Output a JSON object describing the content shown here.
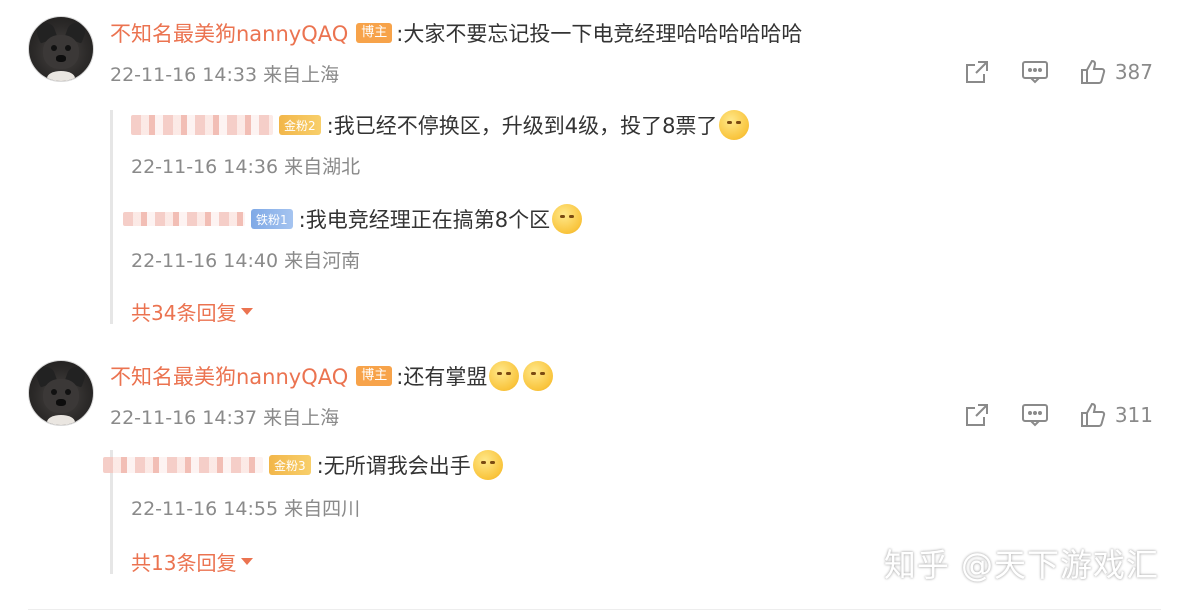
{
  "comments": [
    {
      "username": "不知名最美狗nannyQAQ",
      "badge": "博主",
      "text": ":大家不要忘记投一下电竞经理哈哈哈哈哈哈",
      "meta": "22-11-16 14:33 来自上海",
      "likes": "387",
      "replies": [
        {
          "fan_badge": "金粉2",
          "text": ":我已经不停换区，升级到4级，投了8票了",
          "meta": "22-11-16 14:36 来自湖北"
        },
        {
          "fan_badge": "铁粉1",
          "text": ":我电竞经理正在搞第8个区",
          "meta": "22-11-16 14:40 来自河南"
        }
      ],
      "more_replies": "共34条回复"
    },
    {
      "username": "不知名最美狗nannyQAQ",
      "badge": "博主",
      "text": ":还有掌盟",
      "meta": "22-11-16 14:37 来自上海",
      "likes": "311",
      "replies": [
        {
          "fan_badge": "金粉3",
          "text": ":无所谓我会出手",
          "meta": "22-11-16 14:55 来自四川"
        }
      ],
      "more_replies": "共13条回复"
    }
  ],
  "watermark": "知乎 @天下游戏汇",
  "colors": {
    "username": "#eb7350",
    "boss_badge": "#f7a34a",
    "gold_badge": "#f2b64a",
    "iron_badge": "#7fa9e6",
    "meta": "#8a8a8a"
  }
}
